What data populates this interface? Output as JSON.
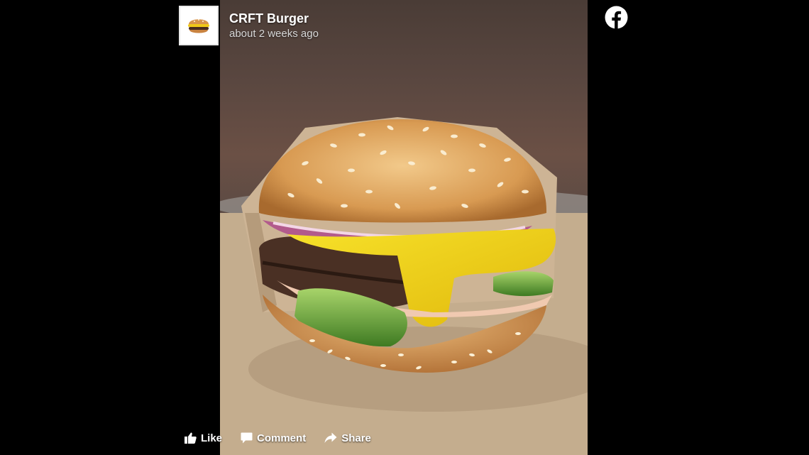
{
  "post": {
    "page_name": "CRFT Burger",
    "timestamp": "about 2 weeks ago",
    "avatar_icon": "burger-avatar-icon",
    "platform_icon": "facebook-icon"
  },
  "actions": {
    "like_label": "Like",
    "comment_label": "Comment",
    "share_label": "Share"
  },
  "colors": {
    "background": "#000000",
    "text": "#ffffff",
    "facebook": "#ffffff"
  }
}
